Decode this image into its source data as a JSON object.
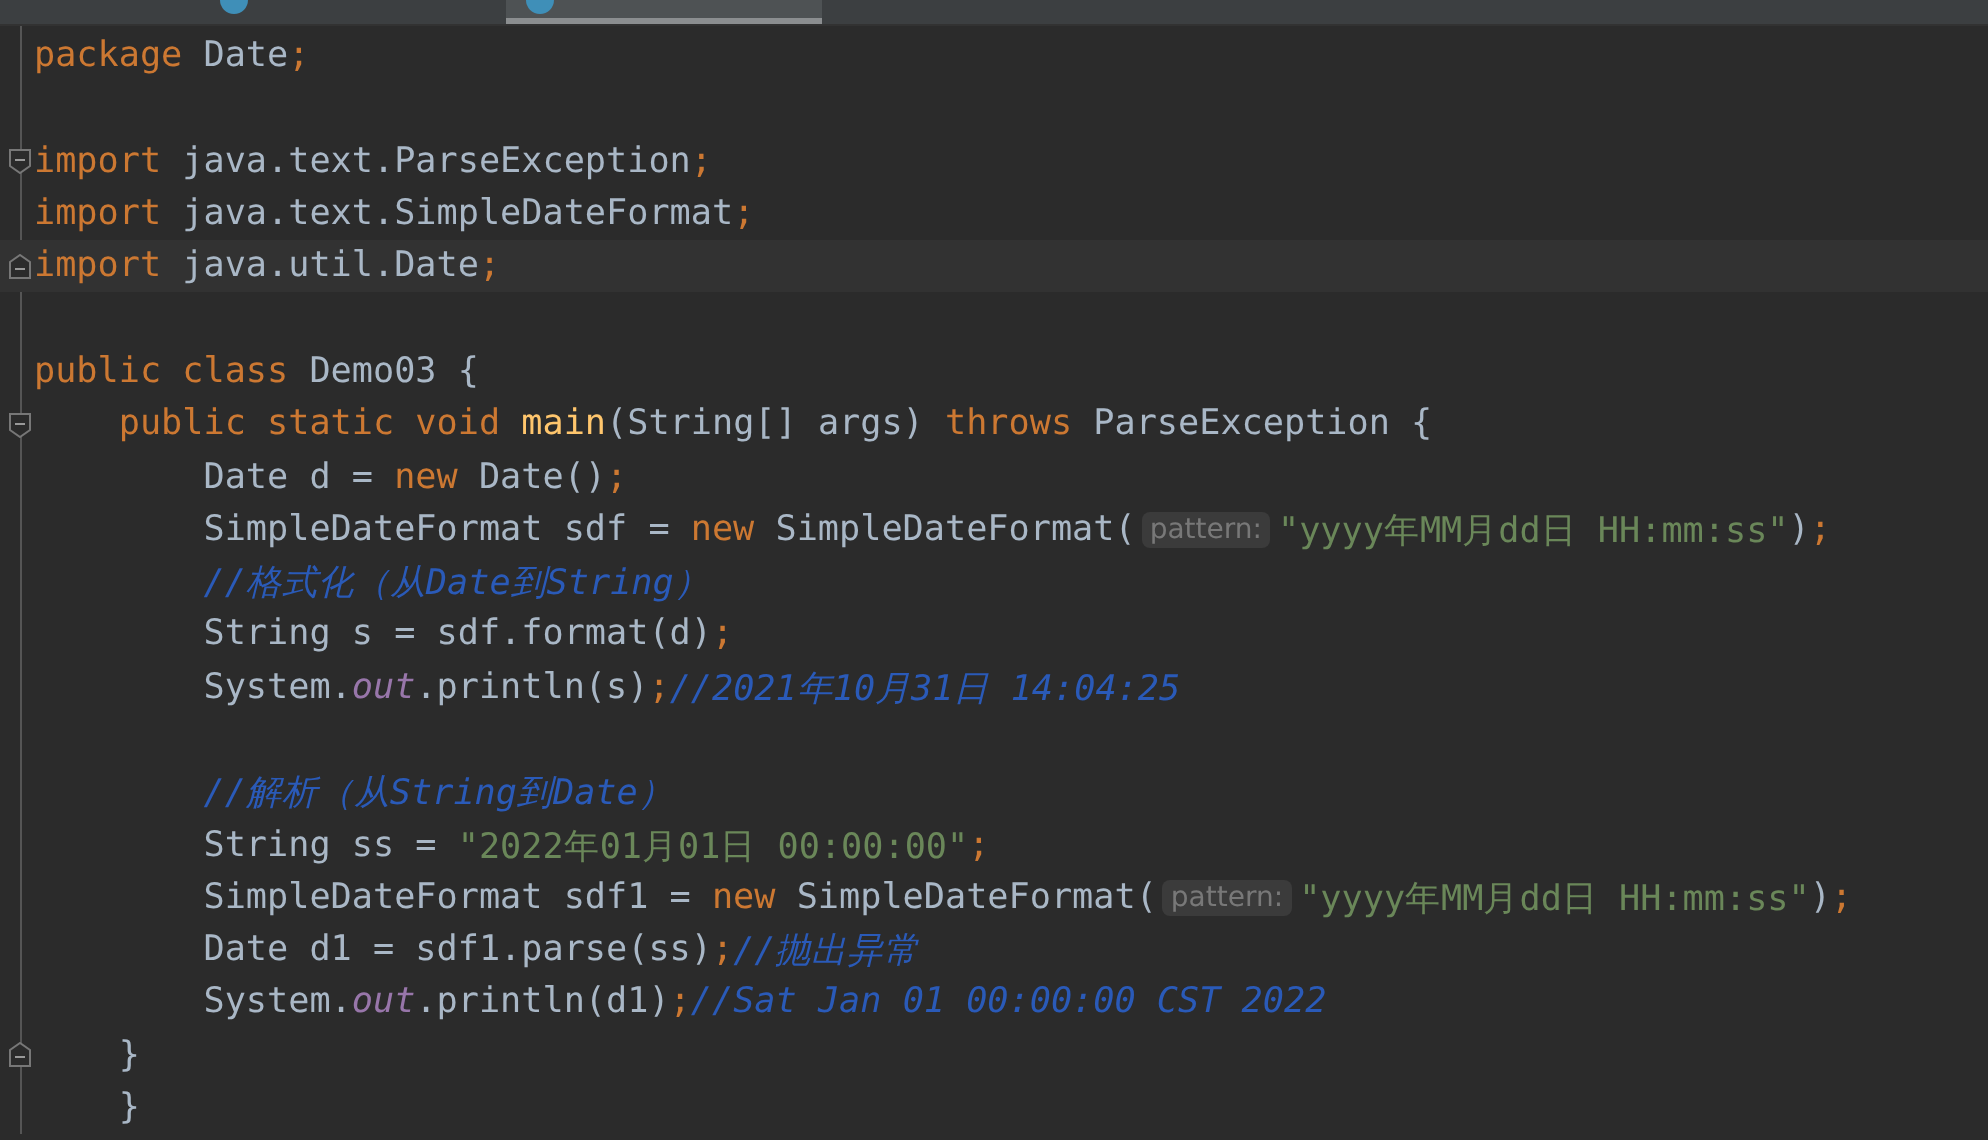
{
  "tabs": [
    {
      "selected": false,
      "icon": true
    },
    {
      "selected": true,
      "icon": true
    }
  ],
  "lines": [
    {
      "kind": "plain",
      "current": false,
      "tokens": [
        {
          "kind": "keyword",
          "text": "package"
        },
        {
          "kind": "plain",
          "text": " Date"
        },
        {
          "kind": "keyword",
          "text": ";"
        }
      ]
    },
    {
      "kind": "plain",
      "current": false
    },
    {
      "kind": "fold-start",
      "current": false,
      "tokens": [
        {
          "kind": "keyword",
          "text": "import"
        },
        {
          "kind": "plain",
          "text": " java.text.ParseException"
        },
        {
          "kind": "keyword",
          "text": ";"
        }
      ]
    },
    {
      "kind": "plain",
      "current": false,
      "tokens": [
        {
          "kind": "keyword",
          "text": "import"
        },
        {
          "kind": "plain",
          "text": " java.text.SimpleDateFormat"
        },
        {
          "kind": "keyword",
          "text": ";"
        }
      ]
    },
    {
      "kind": "fold-end",
      "current": true,
      "tokens": [
        {
          "kind": "keyword",
          "text": "import"
        },
        {
          "kind": "plain",
          "text": " java.util.Date"
        },
        {
          "kind": "keyword",
          "text": ";"
        }
      ]
    },
    {
      "kind": "plain",
      "current": false
    },
    {
      "kind": "plain",
      "current": false,
      "tokens": [
        {
          "kind": "keyword",
          "text": "public class"
        },
        {
          "kind": "plain",
          "text": " Demo03 {"
        }
      ]
    },
    {
      "kind": "fold-start",
      "current": false,
      "tokens": [
        {
          "kind": "keyword",
          "text": "    public static void"
        },
        {
          "kind": "method",
          "text": " main"
        },
        {
          "kind": "plain",
          "text": "(String[] args) "
        },
        {
          "kind": "keyword",
          "text": "throws"
        },
        {
          "kind": "plain",
          "text": " ParseException {"
        }
      ]
    },
    {
      "kind": "plain",
      "current": false,
      "tokens": [
        {
          "kind": "plain",
          "text": "        Date d = "
        },
        {
          "kind": "keyword",
          "text": "new"
        },
        {
          "kind": "plain",
          "text": " Date()"
        },
        {
          "kind": "keyword",
          "text": ";"
        }
      ]
    },
    {
      "kind": "plain",
      "current": false,
      "tokens": [
        {
          "kind": "plain",
          "text": "        SimpleDateFormat sdf = "
        },
        {
          "kind": "keyword",
          "text": "new"
        },
        {
          "kind": "plain",
          "text": " SimpleDateFormat("
        },
        {
          "kind": "hint",
          "text": "pattern:"
        },
        {
          "kind": "string",
          "text": "\"yyyy年MM月dd日 HH:mm:ss\""
        },
        {
          "kind": "plain",
          "text": ")"
        },
        {
          "kind": "keyword",
          "text": ";"
        }
      ]
    },
    {
      "kind": "plain",
      "current": false,
      "tokens": [
        {
          "kind": "comment",
          "text": "        //格式化（从Date到String）"
        }
      ]
    },
    {
      "kind": "plain",
      "current": false,
      "tokens": [
        {
          "kind": "plain",
          "text": "        String s = sdf.format(d)"
        },
        {
          "kind": "keyword",
          "text": ";"
        }
      ]
    },
    {
      "kind": "plain",
      "current": false,
      "tokens": [
        {
          "kind": "plain",
          "text": "        System."
        },
        {
          "kind": "field",
          "text": "out"
        },
        {
          "kind": "plain",
          "text": ".println(s)"
        },
        {
          "kind": "keyword",
          "text": ";"
        },
        {
          "kind": "comment",
          "text": "//2021年10月31日 14:04:25"
        }
      ]
    },
    {
      "kind": "plain",
      "current": false
    },
    {
      "kind": "plain",
      "current": false,
      "tokens": [
        {
          "kind": "comment",
          "text": "        //解析（从String到Date）"
        }
      ]
    },
    {
      "kind": "plain",
      "current": false,
      "tokens": [
        {
          "kind": "plain",
          "text": "        String ss = "
        },
        {
          "kind": "string",
          "text": "\"2022年01月01日 00:00:00\""
        },
        {
          "kind": "keyword",
          "text": ";"
        }
      ]
    },
    {
      "kind": "plain",
      "current": false,
      "tokens": [
        {
          "kind": "plain",
          "text": "        SimpleDateFormat sdf1 = "
        },
        {
          "kind": "keyword",
          "text": "new"
        },
        {
          "kind": "plain",
          "text": " SimpleDateFormat("
        },
        {
          "kind": "hint",
          "text": "pattern:"
        },
        {
          "kind": "string",
          "text": "\"yyyy年MM月dd日 HH:mm:ss\""
        },
        {
          "kind": "plain",
          "text": ")"
        },
        {
          "kind": "keyword",
          "text": ";"
        }
      ]
    },
    {
      "kind": "plain",
      "current": false,
      "tokens": [
        {
          "kind": "plain",
          "text": "        Date d1 = sdf1.parse(ss)"
        },
        {
          "kind": "keyword",
          "text": ";"
        },
        {
          "kind": "comment",
          "text": "//抛出异常"
        }
      ]
    },
    {
      "kind": "plain",
      "current": false,
      "tokens": [
        {
          "kind": "plain",
          "text": "        System."
        },
        {
          "kind": "field",
          "text": "out"
        },
        {
          "kind": "plain",
          "text": ".println(d1)"
        },
        {
          "kind": "keyword",
          "text": ";"
        },
        {
          "kind": "comment",
          "text": "//Sat Jan 01 00:00:00 CST 2022"
        }
      ]
    },
    {
      "kind": "fold-end",
      "current": false,
      "tokens": [
        {
          "kind": "plain",
          "text": "    }"
        }
      ]
    },
    {
      "kind": "plain",
      "current": false,
      "tokens": [
        {
          "kind": "plain",
          "text": "    }"
        }
      ]
    }
  ]
}
